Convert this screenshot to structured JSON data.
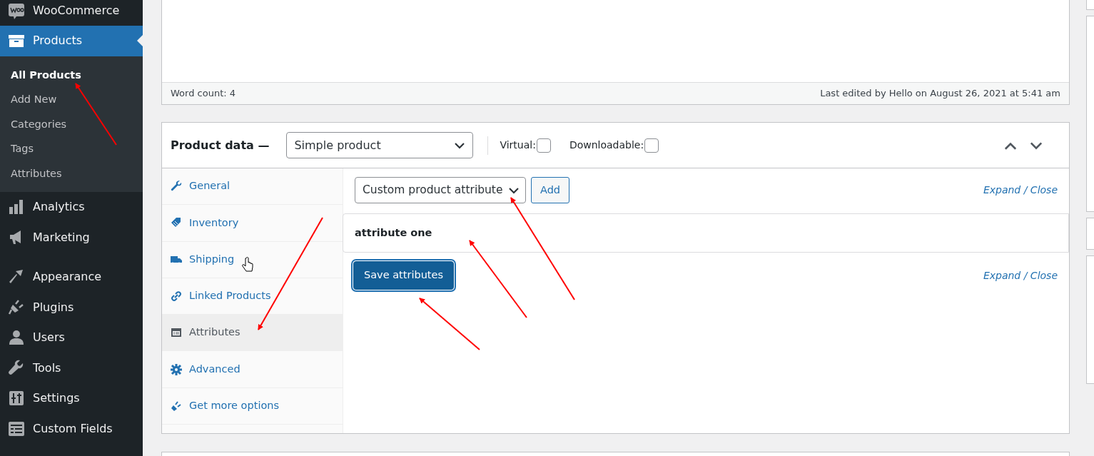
{
  "sidebar": {
    "groups": [
      {
        "menu": [
          {
            "label": "WooCommerce",
            "selected": false
          },
          {
            "label": "Products",
            "selected": true,
            "children": [
              {
                "label": "All Products",
                "selected": true
              },
              {
                "label": "Add New",
                "selected": false
              },
              {
                "label": "Categories",
                "selected": false
              },
              {
                "label": "Tags",
                "selected": false
              },
              {
                "label": "Attributes",
                "selected": false
              }
            ]
          },
          {
            "label": "Analytics",
            "selected": false
          },
          {
            "label": "Marketing",
            "selected": false
          }
        ]
      },
      {
        "menu": [
          {
            "label": "Appearance",
            "selected": false
          },
          {
            "label": "Plugins",
            "selected": false
          },
          {
            "label": "Users",
            "selected": false
          },
          {
            "label": "Tools",
            "selected": false
          },
          {
            "label": "Settings",
            "selected": false
          },
          {
            "label": "Custom Fields",
            "selected": false
          }
        ]
      }
    ]
  },
  "editor": {
    "word_count": "Word count: 4",
    "last_edited": "Last edited by Hello on August 26, 2021 at 5:41 am"
  },
  "product_data": {
    "title": "Product data —",
    "product_type": "Simple product",
    "checkboxes": [
      {
        "label": "Virtual:",
        "checked": false
      },
      {
        "label": "Downloadable:",
        "checked": false
      }
    ],
    "tabs": [
      {
        "label": "General",
        "selected": false
      },
      {
        "label": "Inventory",
        "selected": false
      },
      {
        "label": "Shipping",
        "selected": false
      },
      {
        "label": "Linked Products",
        "selected": false
      },
      {
        "label": "Attributes",
        "selected": true
      },
      {
        "label": "Advanced",
        "selected": false
      },
      {
        "label": "Get more options",
        "selected": false
      }
    ],
    "attribute_select": "Custom product attribute",
    "add_button": "Add",
    "expand_close_top": {
      "expand": "Expand",
      "separator": "/",
      "close": "Close"
    },
    "attributes": [
      {
        "name": "attribute one"
      }
    ],
    "save_button": "Save attributes",
    "expand_close_bottom": {
      "expand": "Expand",
      "separator": "/",
      "close": "Close"
    }
  }
}
